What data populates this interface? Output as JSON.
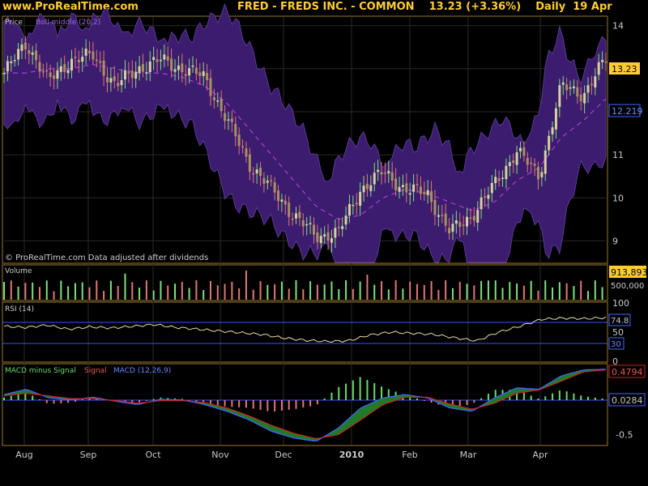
{
  "header": {
    "site": "www.ProRealTime.com",
    "symbol": "FRED - FREDS INC. - COMMON",
    "last": "13.23 (+3.36%)",
    "period": "Daily",
    "date": "19 Apr"
  },
  "panels": {
    "price": {
      "label": "Price",
      "indicator": "Boll middle (20,2)",
      "footnote": "© ProRealTime.com Data adjusted after dividends"
    },
    "volume": {
      "label": "Volume"
    },
    "rsi": {
      "label": "RSI (14)"
    },
    "macd": {
      "label_a": "MACD minus Signal",
      "label_b": "Signal",
      "label_c": "MACD (12,26,9)"
    }
  },
  "colors": {
    "band": "#3b1c6e",
    "band_edge": "#7a55b0",
    "bollmid": "#b23cd8",
    "up": "#7ee07e",
    "down": "#e07777",
    "rsi_line": "#e8d9a8",
    "rsi_lines": "#3355ff",
    "macd_line": "#4466ff",
    "signal_line": "#cc2222",
    "macd_hist": "#66dd66",
    "frame": "#9a7a2c",
    "grid": "#2a2a2a",
    "axis_text": "#c9c9c9",
    "badge": "#ffcc33"
  },
  "chart_data": [
    {
      "type": "candlestick",
      "title": "Price",
      "x": [
        "Aug",
        "Sep",
        "Oct",
        "Nov",
        "Dec",
        "2010",
        "Feb",
        "Mar",
        "Apr"
      ],
      "yticks": [
        9,
        10,
        11,
        12,
        13,
        14
      ],
      "ylim": [
        8.5,
        14.2
      ],
      "close_path": [
        [
          "Aug",
          12.9
        ],
        [
          "Aug",
          13.6
        ],
        [
          "Aug",
          12.7
        ],
        [
          "Aug",
          13.2
        ],
        [
          "Sep",
          13.3
        ],
        [
          "Sep",
          12.6
        ],
        [
          "Sep",
          13.0
        ],
        [
          "Oct",
          13.2
        ],
        [
          "Oct",
          13.0
        ],
        [
          "Oct",
          12.8
        ],
        [
          "Nov",
          11.8
        ],
        [
          "Nov",
          10.8
        ],
        [
          "Nov",
          10.2
        ],
        [
          "Dec",
          9.6
        ],
        [
          "Dec",
          9.1
        ],
        [
          "Dec",
          9.2
        ],
        [
          "2010",
          10.2
        ],
        [
          "2010",
          10.6
        ],
        [
          "2010",
          10.2
        ],
        [
          "Feb",
          10.1
        ],
        [
          "Feb",
          9.2
        ],
        [
          "Feb",
          9.6
        ],
        [
          "Mar",
          10.3
        ],
        [
          "Mar",
          11.1
        ],
        [
          "Mar",
          10.5
        ],
        [
          "Apr",
          12.6
        ],
        [
          "Apr",
          12.4
        ],
        [
          "Apr",
          13.23
        ]
      ],
      "series": [
        {
          "name": "Boll middle (20,2)",
          "values": [
            12.9,
            12.9,
            13.0,
            13.0,
            13.1,
            13.0,
            12.9,
            12.9,
            12.8,
            12.6,
            12.2,
            11.6,
            11.0,
            10.4,
            9.8,
            9.5,
            9.6,
            10.0,
            10.2,
            10.1,
            9.9,
            9.7,
            9.9,
            10.4,
            10.7,
            11.4,
            11.8,
            12.3
          ]
        }
      ],
      "last_badge": "13.23",
      "mid_badge": "12.219"
    },
    {
      "type": "bar",
      "title": "Volume",
      "yticks_labels": [
        "500,000"
      ],
      "last_badge": "913,893"
    },
    {
      "type": "line",
      "title": "RSI (14)",
      "yticks": [
        0,
        50,
        100
      ],
      "ylim": [
        0,
        100
      ],
      "levels": [
        30,
        74.8
      ],
      "values": [
        60,
        58,
        62,
        55,
        59,
        57,
        60,
        63,
        58,
        55,
        52,
        49,
        46,
        40,
        36,
        34,
        35,
        45,
        50,
        48,
        46,
        40,
        35,
        50,
        60,
        72,
        74,
        73,
        74.8
      ],
      "last_badge": "74.8",
      "low_badge": "30"
    },
    {
      "type": "line",
      "title": "MACD (12,26,9)",
      "yticks": [
        -0.5
      ],
      "ylim": [
        -0.65,
        0.55
      ],
      "series": [
        {
          "name": "MACD",
          "values": [
            0.1,
            0.18,
            0.05,
            0.02,
            0.06,
            0.0,
            -0.05,
            0.03,
            0.02,
            -0.05,
            -0.15,
            -0.28,
            -0.45,
            -0.55,
            -0.6,
            -0.4,
            -0.1,
            0.05,
            0.1,
            0.05,
            -0.1,
            -0.15,
            0.05,
            0.2,
            0.18,
            0.38,
            0.47,
            0.4794
          ]
        },
        {
          "name": "Signal",
          "values": [
            0.08,
            0.12,
            0.08,
            0.04,
            0.04,
            0.01,
            -0.03,
            0.01,
            0.01,
            -0.02,
            -0.1,
            -0.22,
            -0.36,
            -0.48,
            -0.56,
            -0.5,
            -0.28,
            -0.05,
            0.06,
            0.06,
            -0.04,
            -0.12,
            -0.03,
            0.12,
            0.17,
            0.3,
            0.44,
            0.47
          ]
        }
      ],
      "last_badge": "0.4794",
      "hist_badge": "0.0284"
    }
  ]
}
